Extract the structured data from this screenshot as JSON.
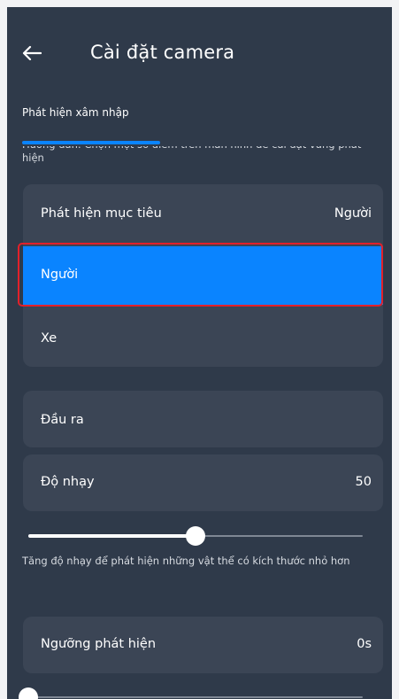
{
  "header": {
    "title": "Cài đặt camera",
    "back_icon": "arrow-left-icon"
  },
  "tab": {
    "label": "Phát hiện xâm nhập"
  },
  "hint": "Hướng dẫn: Chọn một số điểm trên màn hình để cài đặt vùng phát hiện",
  "target_detection": {
    "label": "Phát hiện mục tiêu",
    "value": "Người",
    "options": [
      "Người",
      "Xe"
    ]
  },
  "output": {
    "label": "Đầu ra"
  },
  "sensitivity": {
    "label": "Độ nhạy",
    "value": "50",
    "slider_fraction": 0.5,
    "description": "Tăng độ nhạy để phát hiện những vật thể có kích thước nhỏ hơn"
  },
  "threshold": {
    "label": "Ngưỡng phát hiện",
    "value": "0s",
    "slider_fraction": 0
  },
  "colors": {
    "background": "#2f3a4a",
    "card": "#3b4555",
    "accent": "#0a84ff",
    "highlight_outline": "#e3202a"
  }
}
